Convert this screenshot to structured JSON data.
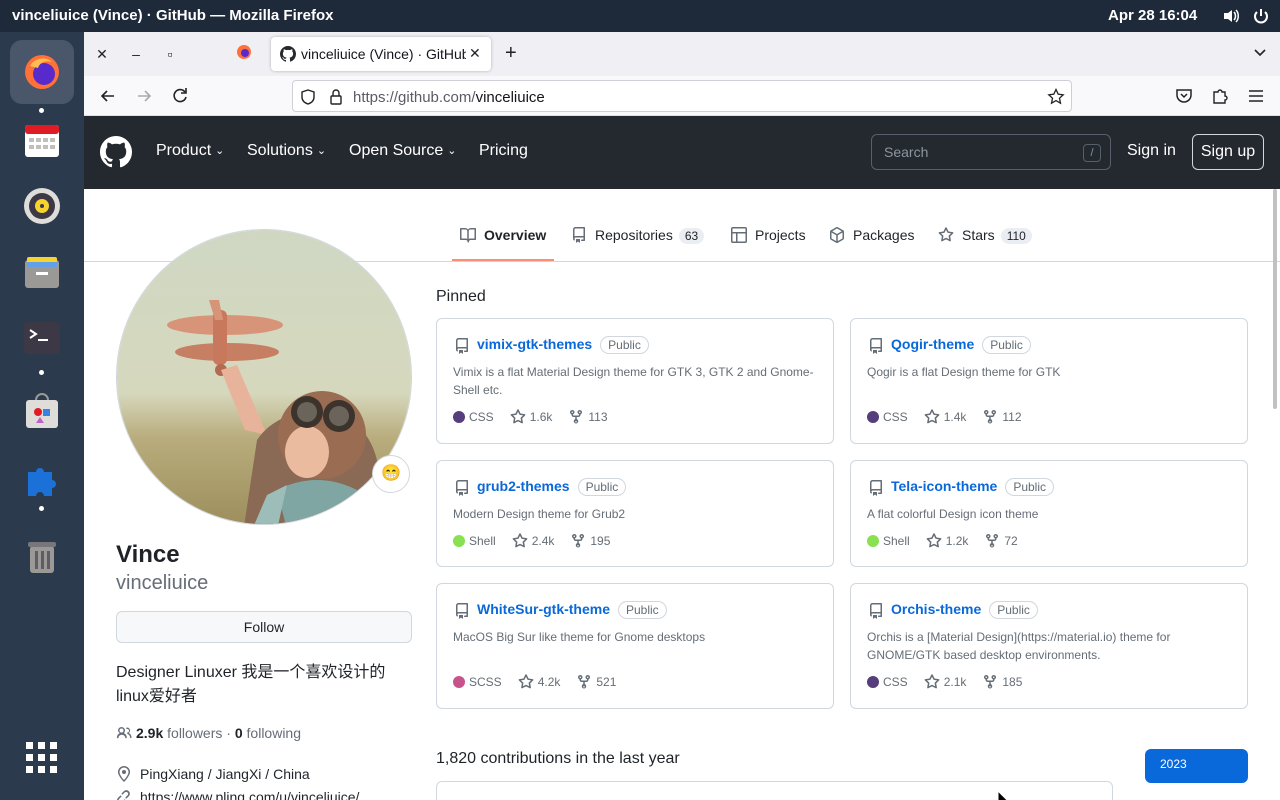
{
  "system": {
    "window_title": "vinceliuice (Vince) · GitHub — Mozilla Firefox",
    "clock": "Apr 28  16:04"
  },
  "dock": {
    "apps": [
      "firefox-icon",
      "calendar-icon",
      "rhythmbox-icon",
      "files-icon",
      "terminal-icon",
      "software-icon",
      "extensions-icon",
      "trash-icon",
      "app-grid-icon"
    ]
  },
  "browser": {
    "tab_title": "vinceliuice (Vince) · GitHub",
    "url_host": "https://github.com/",
    "url_path": "vinceliuice"
  },
  "github_header": {
    "nav": [
      "Product",
      "Solutions",
      "Open Source",
      "Pricing"
    ],
    "search_placeholder": "Search",
    "search_shortcut": "/",
    "sign_in": "Sign in",
    "sign_up": "Sign up"
  },
  "profile_tabs": [
    {
      "label": "Overview",
      "count": ""
    },
    {
      "label": "Repositories",
      "count": "63"
    },
    {
      "label": "Projects",
      "count": ""
    },
    {
      "label": "Packages",
      "count": ""
    },
    {
      "label": "Stars",
      "count": "110"
    }
  ],
  "profile": {
    "emoji": "😁",
    "name": "Vince",
    "login": "vinceliuice",
    "follow_label": "Follow",
    "bio": "Designer Linuxer 我是一个喜欢设计的linux爱好者",
    "followers": "2.9k",
    "followers_label": "followers",
    "separator": " · ",
    "following": "0",
    "following_label": "following",
    "location": "PingXiang / JiangXi / China",
    "website": "https://www.pling.com/u/vinceliuice/"
  },
  "pinned": {
    "title": "Pinned",
    "repos": [
      {
        "name": "vimix-gtk-themes",
        "visibility": "Public",
        "desc": "Vimix is a flat Material Design theme for GTK 3, GTK 2 and Gnome-Shell etc.",
        "lang": "CSS",
        "lang_color": "#563d7c",
        "stars": "1.6k",
        "forks": "113"
      },
      {
        "name": "Qogir-theme",
        "visibility": "Public",
        "desc": "Qogir is a flat Design theme for GTK",
        "lang": "CSS",
        "lang_color": "#563d7c",
        "stars": "1.4k",
        "forks": "112"
      },
      {
        "name": "grub2-themes",
        "visibility": "Public",
        "desc": "Modern Design theme for Grub2",
        "lang": "Shell",
        "lang_color": "#89e051",
        "stars": "2.4k",
        "forks": "195"
      },
      {
        "name": "Tela-icon-theme",
        "visibility": "Public",
        "desc": "A flat colorful Design icon theme",
        "lang": "Shell",
        "lang_color": "#89e051",
        "stars": "1.2k",
        "forks": "72"
      },
      {
        "name": "WhiteSur-gtk-theme",
        "visibility": "Public",
        "desc": "MacOS Big Sur like theme for Gnome desktops",
        "lang": "SCSS",
        "lang_color": "#c6538c",
        "stars": "4.2k",
        "forks": "521"
      },
      {
        "name": "Orchis-theme",
        "visibility": "Public",
        "desc": "Orchis is a [Material Design](https://material.io) theme for GNOME/GTK based desktop environments.",
        "lang": "CSS",
        "lang_color": "#563d7c",
        "stars": "2.1k",
        "forks": "185"
      }
    ]
  },
  "contributions": {
    "title": "1,820 contributions in the last year",
    "year": "2023"
  }
}
